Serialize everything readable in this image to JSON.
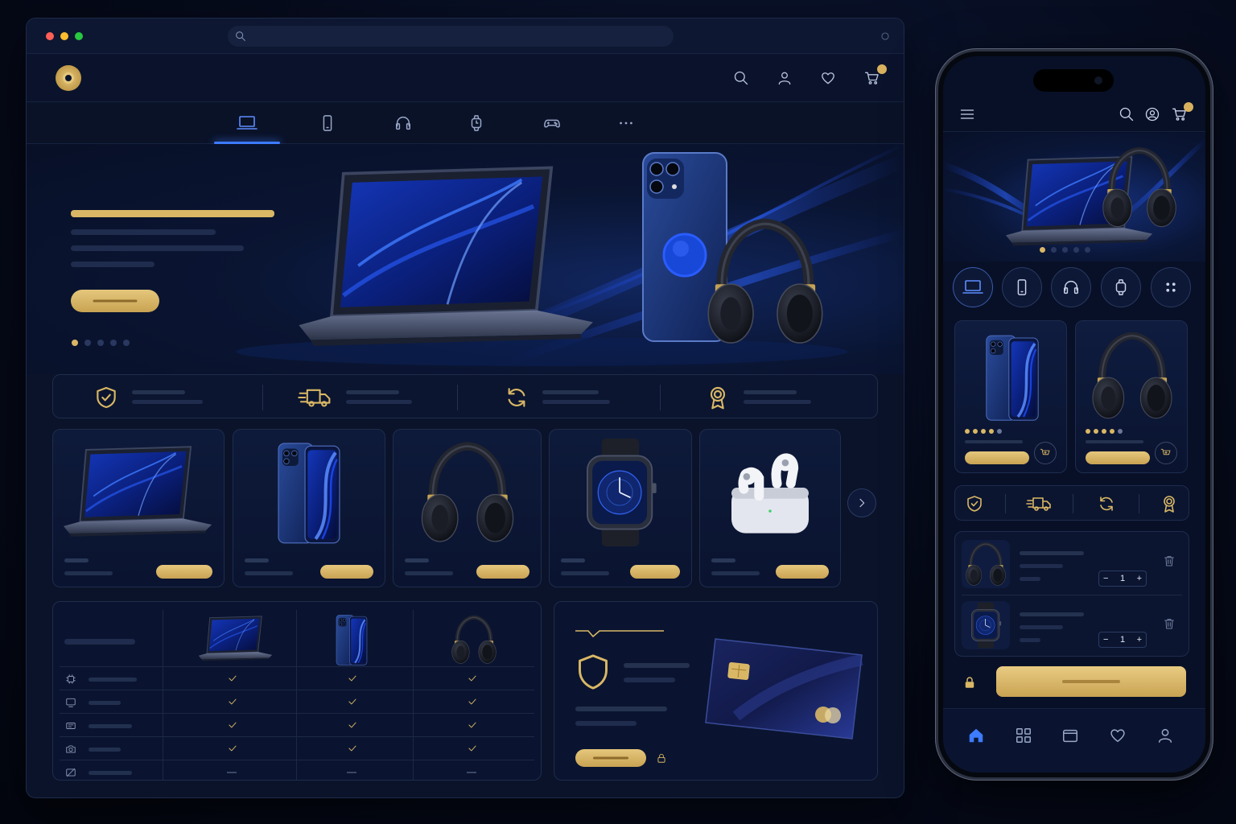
{
  "browser": {
    "traffic_lights": [
      "#ff5f57",
      "#febc2e",
      "#28c840"
    ],
    "address_placeholder": ""
  },
  "header": {
    "icons": [
      "search-icon",
      "user-icon",
      "heart-icon",
      "cart-icon"
    ],
    "cart_badge": ""
  },
  "category_tabs": [
    {
      "icon": "laptop-icon",
      "active": true
    },
    {
      "icon": "phone-icon",
      "active": false
    },
    {
      "icon": "headphones-icon",
      "active": false
    },
    {
      "icon": "watch-icon",
      "active": false
    },
    {
      "icon": "gamepad-icon",
      "active": false
    },
    {
      "icon": "more-icon",
      "active": false
    }
  ],
  "hero": {
    "carousel_slides": 5,
    "active_slide": 1,
    "products_shown": [
      "laptop",
      "smartphone",
      "headphones"
    ]
  },
  "features": [
    {
      "icon": "shield-check-icon"
    },
    {
      "icon": "delivery-truck-icon"
    },
    {
      "icon": "refresh-icon"
    },
    {
      "icon": "award-ribbon-icon"
    }
  ],
  "products": [
    {
      "kind": "laptop"
    },
    {
      "kind": "smartphone"
    },
    {
      "kind": "headphones"
    },
    {
      "kind": "smartwatch"
    },
    {
      "kind": "earbuds"
    }
  ],
  "comparison": {
    "columns": [
      "laptop",
      "smartphone",
      "headphones"
    ],
    "rows": [
      {
        "icon": "cpu-icon",
        "values": [
          true,
          true,
          true
        ]
      },
      {
        "icon": "display-icon",
        "values": [
          true,
          true,
          true
        ]
      },
      {
        "icon": "battery-icon",
        "values": [
          true,
          true,
          true
        ]
      },
      {
        "icon": "camera-icon",
        "values": [
          true,
          true,
          true
        ]
      },
      {
        "icon": "no-camera-icon",
        "values": [
          false,
          false,
          false
        ]
      }
    ]
  },
  "mobile": {
    "cart_badge": "",
    "hero_slides": 5,
    "active_slide": 1,
    "categories": [
      "laptop-icon",
      "phone-icon",
      "headphones-icon",
      "watch-icon",
      "grid-icon"
    ],
    "cards": [
      {
        "kind": "smartphone",
        "rating": 4
      },
      {
        "kind": "headphones",
        "rating": 4
      }
    ],
    "cart_items": [
      {
        "kind": "headphones",
        "qty": "1"
      },
      {
        "kind": "smartwatch",
        "qty": "1"
      }
    ],
    "nav": [
      "home-icon",
      "grid-icon",
      "card-icon",
      "heart-icon",
      "user-icon"
    ],
    "active_nav": "home-icon"
  },
  "colors": {
    "background": "#060b1c",
    "panel": "#0a1430",
    "accent_gold": "#d9b765",
    "accent_blue": "#3d7bff"
  }
}
